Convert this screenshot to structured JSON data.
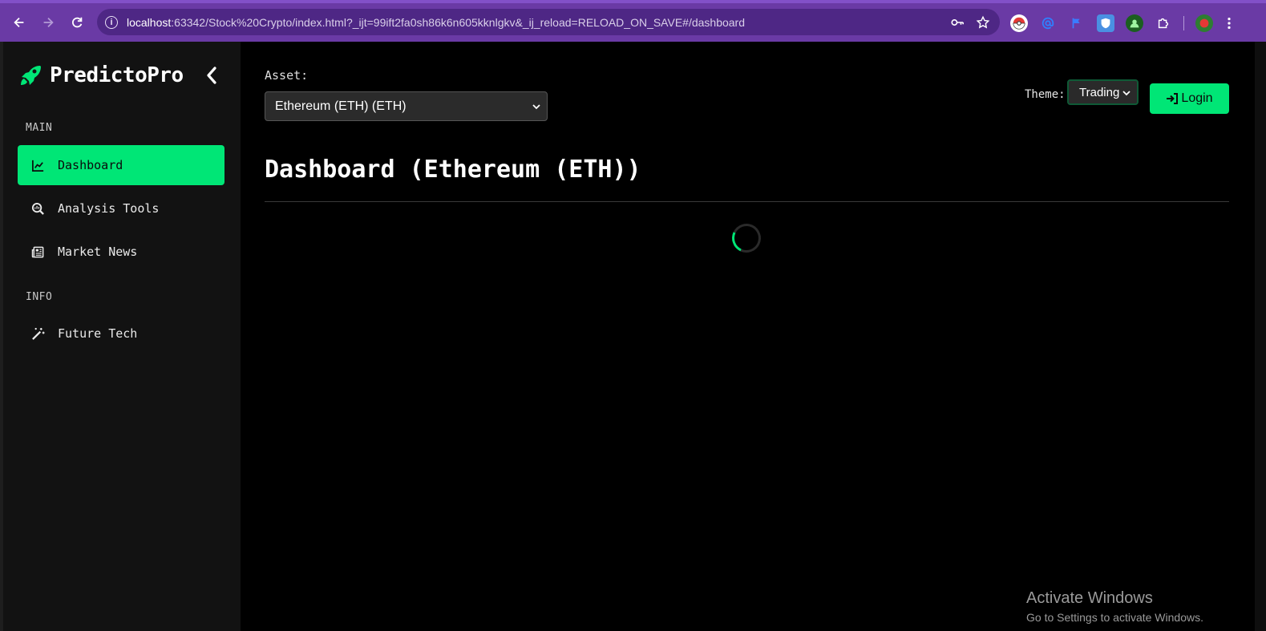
{
  "browser": {
    "url_host": "localhost",
    "url_rest": ":63342/Stock%20Crypto/index.html?_ijt=99ift2fa0sh86k6n605kknlgkv&_ij_reload=RELOAD_ON_SAVE#/dashboard",
    "info_glyph": "i"
  },
  "sidebar": {
    "brand": "PredictoPro",
    "sections": [
      {
        "label": "MAIN"
      },
      {
        "label": "INFO"
      }
    ],
    "items": [
      {
        "label": "Dashboard",
        "icon": "chart-line-icon",
        "active": true
      },
      {
        "label": "Analysis Tools",
        "icon": "search-chart-icon",
        "active": false
      },
      {
        "label": "Market News",
        "icon": "newspaper-icon",
        "active": false
      },
      {
        "label": "Future Tech",
        "icon": "magic-wand-icon",
        "active": false
      }
    ]
  },
  "main": {
    "asset_label": "Asset:",
    "asset_value": "Ethereum (ETH) (ETH)",
    "theme_label": "Theme:",
    "theme_value": "Trading",
    "login_label": "Login",
    "title": "Dashboard (Ethereum (ETH))"
  },
  "watermark": {
    "title": "Activate Windows",
    "subtitle": "Go to Settings to activate Windows."
  },
  "colors": {
    "accent": "#00e676",
    "chrome": "#6a3aa5",
    "sidebar_bg": "#121212",
    "main_bg": "#000000"
  }
}
